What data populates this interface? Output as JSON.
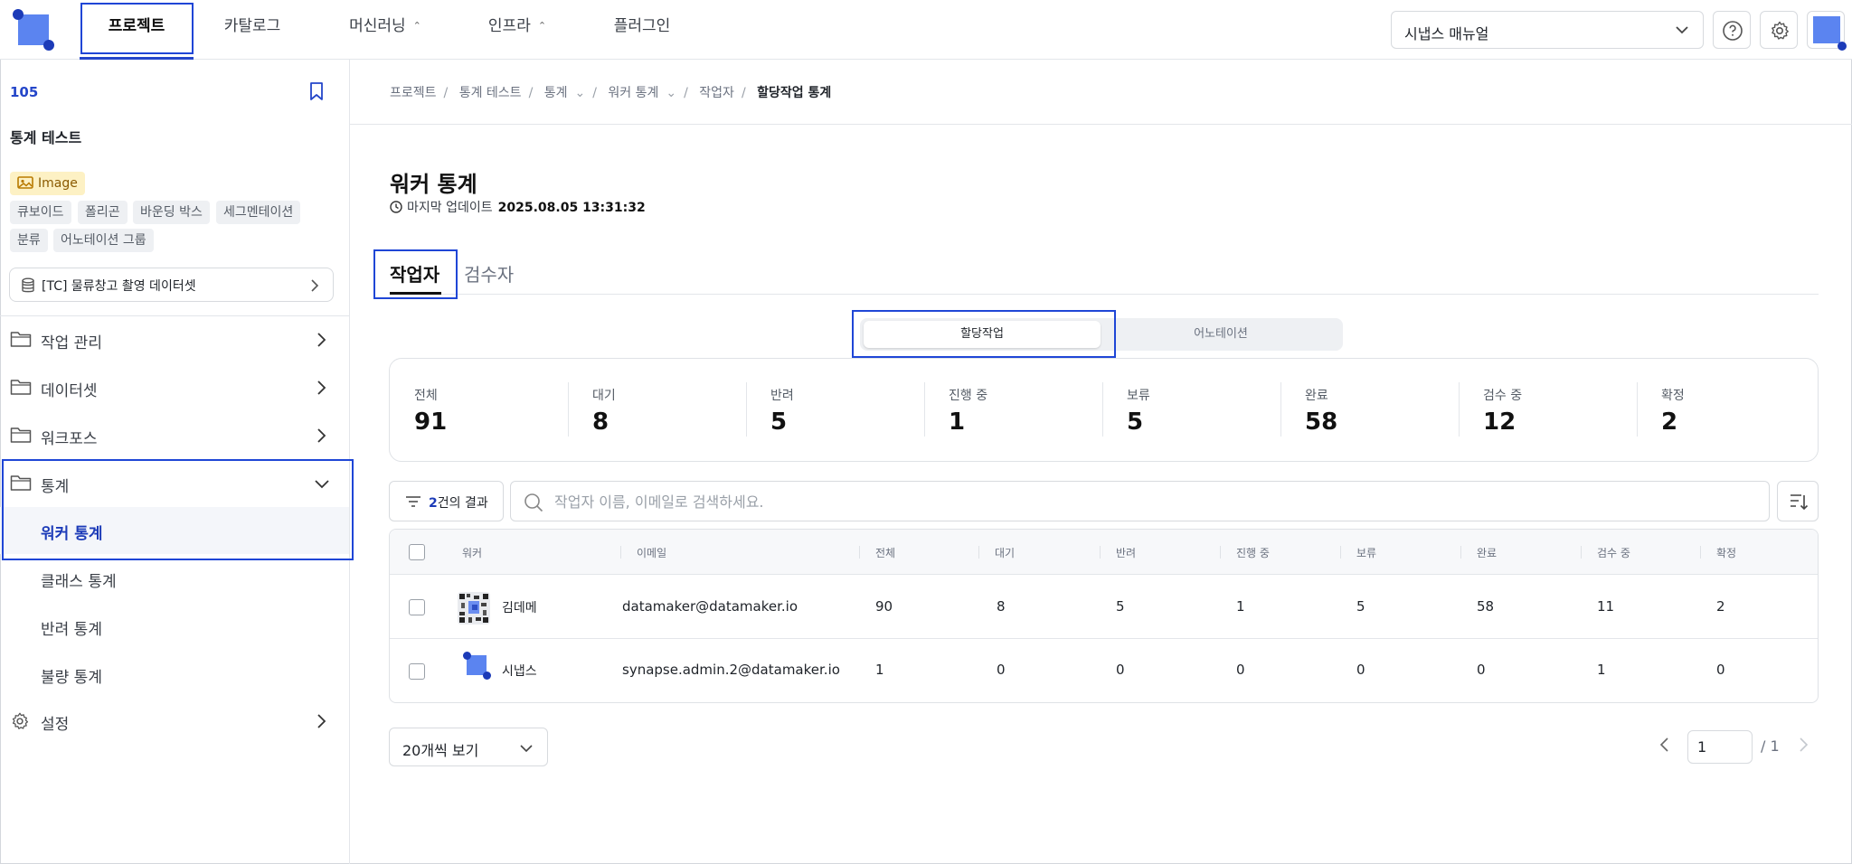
{
  "topnav": {
    "items": [
      {
        "label": "프로젝트"
      },
      {
        "label": "카탈로그"
      },
      {
        "label": "머신러닝"
      },
      {
        "label": "인프라"
      },
      {
        "label": "플러그인"
      }
    ],
    "manual_select": "시냅스 매뉴얼",
    "accent": "#2446c9"
  },
  "sidebar": {
    "project_id": "105",
    "project_name": "통계 테스트",
    "data_type": "Image",
    "tags": [
      "큐보이드",
      "폴리곤",
      "바운딩 박스",
      "세그멘테이션",
      "분류",
      "어노테이션 그룹"
    ],
    "dataset": "[TC] 물류창고 촬영 데이터셋",
    "menu": [
      {
        "label": "작업 관리"
      },
      {
        "label": "데이터셋"
      },
      {
        "label": "워크포스"
      },
      {
        "label": "통계"
      }
    ],
    "stats_sub": [
      {
        "label": "워커 통계"
      },
      {
        "label": "클래스 통계"
      },
      {
        "label": "반려 통계"
      },
      {
        "label": "불량 통계"
      }
    ],
    "settings": "설정"
  },
  "breadcrumb": [
    "프로젝트",
    "통계 테스트",
    "통계",
    "워커 통계",
    "작업자",
    "할당작업 통계"
  ],
  "page": {
    "title": "워커 통계",
    "last_update_label": "마지막 업데이트",
    "last_update_value": "2025.08.05 13:31:32"
  },
  "tabs": [
    "작업자",
    "검수자"
  ],
  "segment": [
    "할당작업",
    "어노테이션"
  ],
  "stats": [
    {
      "label": "전체",
      "value": "91"
    },
    {
      "label": "대기",
      "value": "8"
    },
    {
      "label": "반려",
      "value": "5"
    },
    {
      "label": "진행 중",
      "value": "1"
    },
    {
      "label": "보류",
      "value": "5"
    },
    {
      "label": "완료",
      "value": "58"
    },
    {
      "label": "검수 중",
      "value": "12"
    },
    {
      "label": "확정",
      "value": "2"
    }
  ],
  "filter": {
    "count": "2",
    "suffix": "건의 결과"
  },
  "search": {
    "placeholder": "작업자 이름, 이메일로 검색하세요."
  },
  "table": {
    "headers": [
      "워커",
      "이메일",
      "전체",
      "대기",
      "반려",
      "진행 중",
      "보류",
      "완료",
      "검수 중",
      "확정"
    ],
    "rows": [
      {
        "name": "김데메",
        "email": "datamaker@datamaker.io",
        "total": "90",
        "waiting": "8",
        "rejected": "5",
        "in_progress": "1",
        "on_hold": "5",
        "done": "58",
        "reviewing": "11",
        "confirmed": "2"
      },
      {
        "name": "시냅스",
        "email": "synapse.admin.2@datamaker.io",
        "total": "1",
        "waiting": "0",
        "rejected": "0",
        "in_progress": "0",
        "on_hold": "0",
        "done": "0",
        "reviewing": "1",
        "confirmed": "0"
      }
    ]
  },
  "pagination": {
    "per_page": "20개씩 보기",
    "current": "1",
    "total": "/ 1"
  }
}
